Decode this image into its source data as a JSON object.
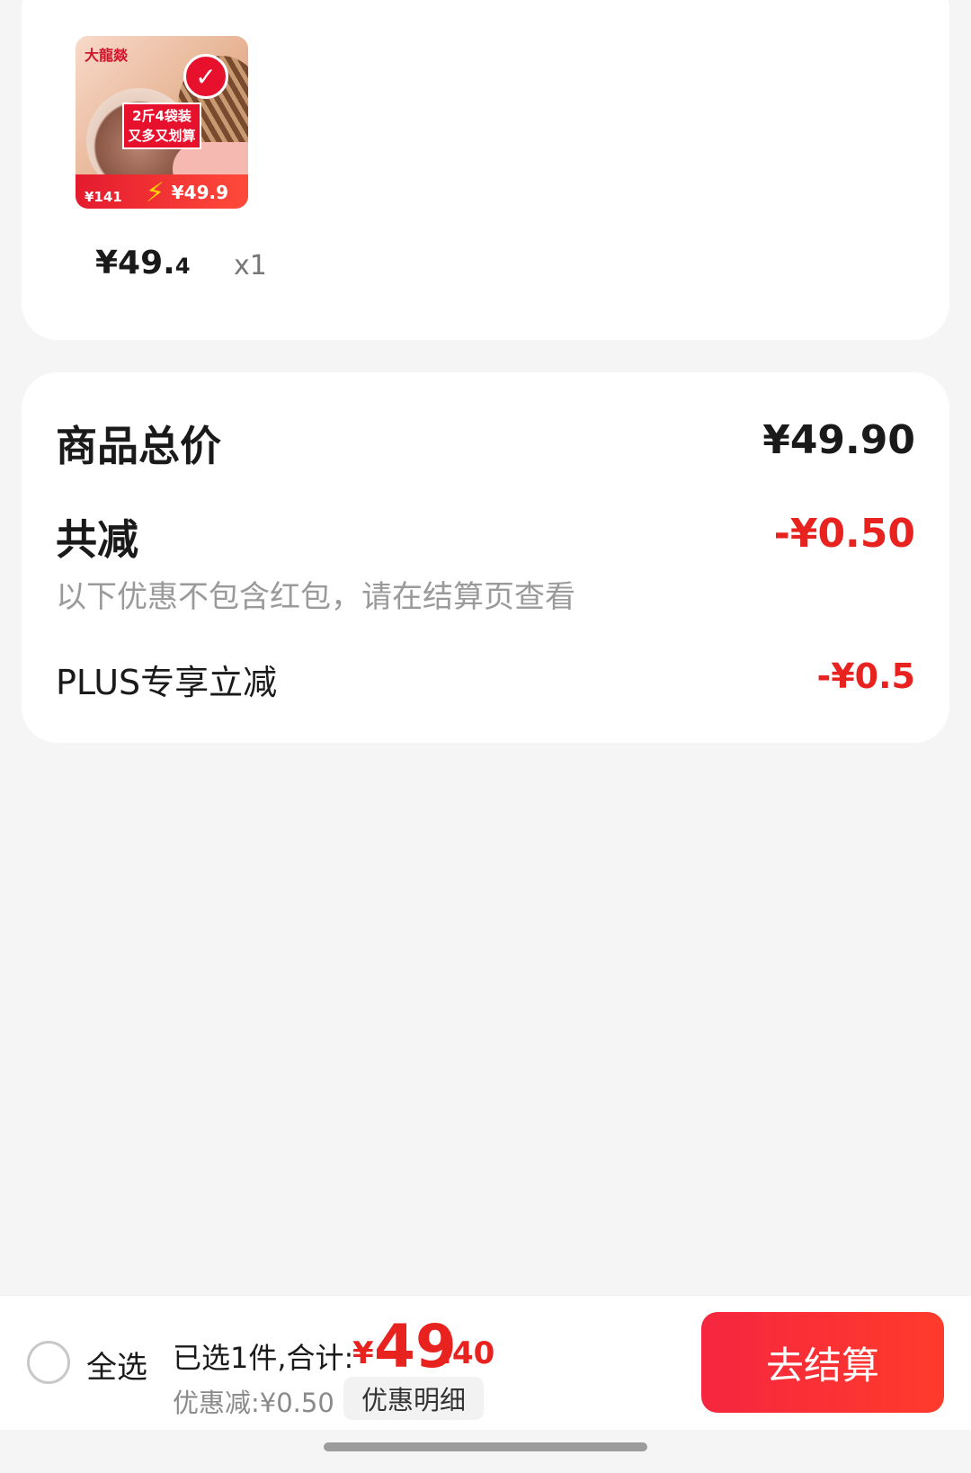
{
  "product": {
    "thumbnail": {
      "brand": "大龍燚",
      "promo_line1": "2斤4袋装",
      "promo_line2": "又多又划算",
      "old_price": "¥141",
      "new_price": "¥49.9",
      "selected_icon": "check-icon"
    },
    "price_int": "¥49.",
    "price_dec": "4",
    "quantity": "x1"
  },
  "summary": {
    "total_label": "商品总价",
    "total_value": "¥49.90",
    "discount_label": "共减",
    "discount_value": "-¥0.50",
    "note": "以下优惠不包含红包，请在结算页查看",
    "plus_label": "PLUS专享立减",
    "plus_value": "-¥0.5"
  },
  "bottom_bar": {
    "select_all": "全选",
    "selected_text": "已选1件,合计:",
    "sum_currency": "¥",
    "sum_int": "49",
    "sum_dec": ".40",
    "saved_text": "优惠减:¥0.50",
    "detail_label": "优惠明细",
    "checkout_label": "去结算"
  },
  "colors": {
    "accent_red": "#e8231f",
    "background": "#f5f5f5"
  }
}
